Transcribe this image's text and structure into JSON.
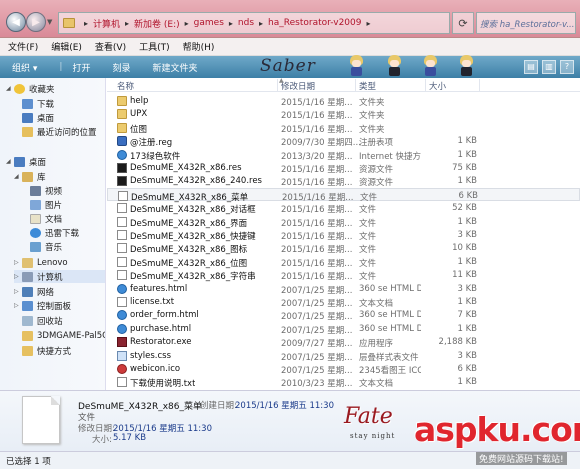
{
  "address": {
    "crumbs": [
      "计算机",
      "新加卷 (E:)",
      "games",
      "nds",
      "ha_Restorator-v2009"
    ],
    "search_placeholder": "搜索 ha_Restorator-v..."
  },
  "menu": [
    "文件(F)",
    "编辑(E)",
    "查看(V)",
    "工具(T)",
    "帮助(H)"
  ],
  "toolbar": {
    "organize": "组织 ▾",
    "open": "打开",
    "burn": "刻录",
    "new_folder": "新建文件夹",
    "saber_text": "Saber"
  },
  "sidebar": {
    "favorites": "收藏夹",
    "downloads": "下载",
    "desktop_fav": "桌面",
    "recent": "最近访问的位置",
    "desktop": "桌面",
    "library": "库",
    "videos": "视频",
    "pictures": "图片",
    "documents": "文档",
    "thunder": "迅雷下载",
    "music": "音乐",
    "lenovo": "Lenovo",
    "computer": "计算机",
    "network": "网络",
    "control_panel": "控制面板",
    "recycle": "回收站",
    "game3dm": "3DMGAME-Pal5Q/",
    "shortcuts": "快捷方式"
  },
  "columns": {
    "name": "名称",
    "date": "修改日期",
    "type": "类型",
    "size": "大小"
  },
  "files": [
    {
      "name": "help",
      "date": "2015/1/16 星期...",
      "type": "文件夹",
      "size": "",
      "icon": "folder"
    },
    {
      "name": "UPX",
      "date": "2015/1/16 星期...",
      "type": "文件夹",
      "size": "",
      "icon": "folder"
    },
    {
      "name": "位图",
      "date": "2015/1/16 星期...",
      "type": "文件夹",
      "size": "",
      "icon": "folder"
    },
    {
      "name": "@注册.reg",
      "date": "2009/7/30 星期四...",
      "type": "注册表项",
      "size": "1 KB",
      "icon": "reg"
    },
    {
      "name": "173绿色软件",
      "date": "2013/3/20 星期...",
      "type": "Internet 快捷方式",
      "size": "1 KB",
      "icon": "web"
    },
    {
      "name": "DeSmuME_X432R_x86.res",
      "date": "2015/1/16 星期...",
      "type": "资源文件",
      "size": "75 KB",
      "icon": "res"
    },
    {
      "name": "DeSmuME_X432R_x86_240.res",
      "date": "2015/1/16 星期...",
      "type": "资源文件",
      "size": "1 KB",
      "icon": "res"
    },
    {
      "name": "DeSmuME_X432R_x86_菜单",
      "date": "2015/1/16 星期...",
      "type": "文件",
      "size": "6 KB",
      "icon": "doc"
    },
    {
      "name": "DeSmuME_X432R_x86_对话框",
      "date": "2015/1/16 星期...",
      "type": "文件",
      "size": "52 KB",
      "icon": "doc"
    },
    {
      "name": "DeSmuME_X432R_x86_界面",
      "date": "2015/1/16 星期...",
      "type": "文件",
      "size": "1 KB",
      "icon": "doc"
    },
    {
      "name": "DeSmuME_X432R_x86_快捷键",
      "date": "2015/1/16 星期...",
      "type": "文件",
      "size": "3 KB",
      "icon": "doc"
    },
    {
      "name": "DeSmuME_X432R_x86_图标",
      "date": "2015/1/16 星期...",
      "type": "文件",
      "size": "10 KB",
      "icon": "doc"
    },
    {
      "name": "DeSmuME_X432R_x86_位图",
      "date": "2015/1/16 星期...",
      "type": "文件",
      "size": "1 KB",
      "icon": "doc"
    },
    {
      "name": "DeSmuME_X432R_x86_字符串",
      "date": "2015/1/16 星期...",
      "type": "文件",
      "size": "11 KB",
      "icon": "doc"
    },
    {
      "name": "features.html",
      "date": "2007/1/25 星期...",
      "type": "360 se HTML Do...",
      "size": "3 KB",
      "icon": "web"
    },
    {
      "name": "license.txt",
      "date": "2007/1/25 星期...",
      "type": "文本文档",
      "size": "1 KB",
      "icon": "doc"
    },
    {
      "name": "order_form.html",
      "date": "2007/1/25 星期...",
      "type": "360 se HTML Do...",
      "size": "7 KB",
      "icon": "web"
    },
    {
      "name": "purchase.html",
      "date": "2007/1/25 星期...",
      "type": "360 se HTML Do...",
      "size": "1 KB",
      "icon": "web"
    },
    {
      "name": "Restorator.exe",
      "date": "2009/7/27 星期...",
      "type": "应用程序",
      "size": "2,188 KB",
      "icon": "exe"
    },
    {
      "name": "styles.css",
      "date": "2007/1/25 星期...",
      "type": "层叠样式表文件",
      "size": "3 KB",
      "icon": "css"
    },
    {
      "name": "webicon.ico",
      "date": "2007/1/25 星期...",
      "type": "2345看图王 ICO ...",
      "size": "6 KB",
      "icon": "ico"
    },
    {
      "name": "下载使用说明.txt",
      "date": "2010/3/23 星期...",
      "type": "文本文档",
      "size": "1 KB",
      "icon": "doc"
    }
  ],
  "details": {
    "name": "DeSmuME_X432R_x86_菜单",
    "kind": "文件",
    "created_label": "创建日期:",
    "created_value": "2015/1/16 星期五 11:30",
    "modified_label": "修改日期:",
    "modified_value": "2015/1/16 星期五 11:30",
    "size_label": "大小:",
    "size_value": "5.17 KB"
  },
  "status": "已选择 1 项",
  "overlay": {
    "fate_logo": "Fate",
    "fate_sub": "stay night",
    "brand": "aspku.com",
    "tagline": "免费网站源码下载站!"
  }
}
